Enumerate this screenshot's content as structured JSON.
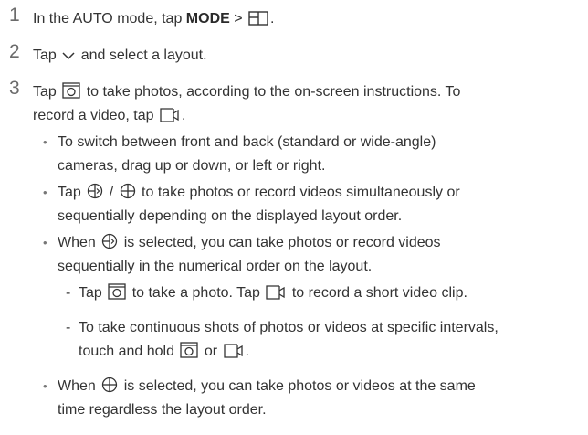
{
  "steps": [
    {
      "number": "1",
      "text_before": "In the AUTO mode, tap ",
      "bold_text": "MODE",
      "text_after": " > ",
      "icon": "split-layout-icon",
      "text_end": "."
    },
    {
      "number": "2",
      "text_before": "Tap ",
      "icon": "chevron-down-icon",
      "text_after": " and select a layout."
    },
    {
      "number": "3",
      "line1_before": "Tap ",
      "line1_icon": "camera-shutter-icon",
      "line1_after": " to take photos, according to the on-screen instructions. To",
      "line2_before": "record a video, tap ",
      "line2_icon": "video-record-icon",
      "line2_after": "."
    }
  ],
  "bullets": [
    {
      "dot": "•",
      "line1": "To switch between front and back (standard or wide-angle)",
      "line2": "cameras, drag up or down, or left or right."
    },
    {
      "dot": "•",
      "line1_before": "Tap ",
      "icon_a": "sequential-shot-icon",
      "separator": " / ",
      "icon_b": "simultaneous-shot-icon",
      "line1_after": " to take photos or record videos simultaneously or",
      "line2": "sequentially depending on the displayed layout order."
    },
    {
      "dot": "•",
      "line1_before": "When ",
      "icon": "sequential-shot-icon",
      "line1_after": " is selected, you can take photos or record videos",
      "line2": "sequentially in the numerical order on the layout."
    },
    {
      "dot": "•",
      "line1_before": "When ",
      "icon": "simultaneous-shot-icon",
      "line1_after": " is selected, you can take photos or videos at the same",
      "line2": "time regardless the layout order."
    }
  ],
  "dashes": [
    {
      "mark": "-",
      "text_a": "Tap ",
      "icon_a": "camera-shutter-icon",
      "text_b": " to take a photo. Tap ",
      "icon_b": "video-record-icon",
      "text_c": " to record a short video clip."
    },
    {
      "mark": "-",
      "line1": "To take continuous shots of photos or videos at specific intervals,",
      "line2_before": "touch and hold ",
      "icon_a": "camera-shutter-icon",
      "line2_mid": " or ",
      "icon_b": "video-record-icon",
      "line2_end": "."
    }
  ],
  "colors": {
    "text": "#333333",
    "step_number": "#6b6b6b"
  }
}
